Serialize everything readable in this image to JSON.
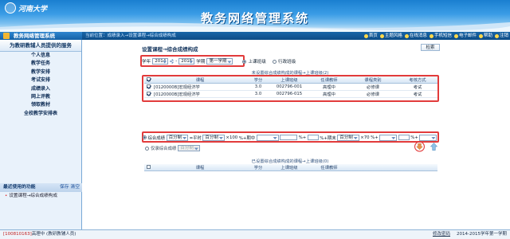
{
  "header": {
    "logo_text": "河南大学",
    "system_title": "教务网络管理系统"
  },
  "topbar": {
    "system_name": "教务网络管理系统",
    "breadcrumb_prefix": "当前位置：",
    "breadcrumb": "成绩录入→设置课程→综合成绩构成",
    "tools": [
      "首页",
      "主题风格",
      "在线消息",
      "手机短信",
      "电子邮件",
      "帮助",
      "注销"
    ]
  },
  "sidebar": {
    "heading": "为教研教辅人员提供的服务",
    "items": [
      "个人信息",
      "教学任务",
      "教学安排",
      "考试安排",
      "成绩录入",
      "网上评教",
      "领取教材",
      "全校教学安排表"
    ],
    "recent_title": "最近使用的功能",
    "recent_actions": "保存 清空",
    "recent_items": [
      "设置课程→综合成绩构成"
    ]
  },
  "main": {
    "tab_title": "设置课程→综合成绩构成",
    "back_button": "检索",
    "filter": {
      "year_label": "学年",
      "year_start": "2014",
      "dash": "-",
      "year_end": "2015",
      "term_label": "学期",
      "term_value": "第一学期",
      "radio_a": "上课班级",
      "radio_b": "行政班级"
    },
    "upper_caption": "未设置综合成绩构成的课程→上课班级(2)",
    "upper_table": {
      "headers": [
        "",
        "课程",
        "学分",
        "上课班级",
        "任课教师",
        "课程类别",
        "考核方式"
      ],
      "rows": [
        [
          "",
          "[0120000B]宏观经济学",
          "3.0",
          "002796-001",
          "高理中",
          "必修课",
          "考试"
        ],
        [
          "",
          "[0120000B]宏观经济学",
          "3.0",
          "002796-015",
          "高理中",
          "必修课",
          "考试"
        ]
      ]
    },
    "formula": {
      "label": "综合成绩",
      "segments": [
        "百分制",
        "=平时",
        "百分制",
        "×100",
        "%+期中",
        "",
        "%+",
        "%+期末",
        "百分制",
        "×70",
        "%+",
        "",
        "%+",
        ""
      ],
      "second_label": "仅录综合成绩",
      "second_select": "百分制"
    },
    "lower_caption": "已设置综合成绩构成的课程→上课班级(0)",
    "lower_table": {
      "headers": [
        "",
        "课程",
        "学分",
        "上课班级",
        "任课教师"
      ]
    }
  },
  "footer": {
    "user": "[100810163]",
    "user_suffix": "高理中 (教研教辅人员)",
    "change_pwd": "修改密码",
    "term_info": "2014-2015学年第一学期"
  },
  "colors": {
    "banner": "#1a7fd0",
    "highlight_box": "#e23b3b",
    "nav_bar": "#0d4c86"
  }
}
